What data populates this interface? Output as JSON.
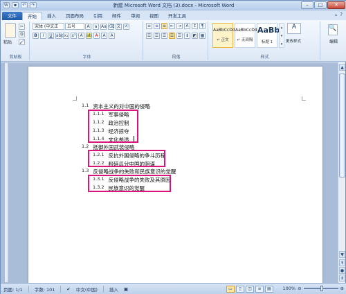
{
  "window": {
    "title": "新建 Microsoft Word 文档 (3).docx - Microsoft Word"
  },
  "qat": {
    "icons": [
      "save-icon",
      "undo-icon",
      "redo-icon"
    ]
  },
  "tabs": [
    "文件",
    "开始",
    "插入",
    "页面布局",
    "引用",
    "邮件",
    "审阅",
    "视图",
    "开发工具"
  ],
  "ribbon": {
    "clipboard": {
      "paste": "粘贴",
      "label": "剪贴板"
    },
    "font": {
      "family": "宋体 (中文正",
      "size": "五号",
      "label": "字体"
    },
    "paragraph": {
      "label": "段落"
    },
    "styles": {
      "label": "样式",
      "items": [
        {
          "preview": "AaBbCcDd",
          "name": "↵ 正文"
        },
        {
          "preview": "AaBbCcDd",
          "name": "↵ 无间隔"
        },
        {
          "preview": "AaBb",
          "name": "标题 1"
        }
      ],
      "change_styles": "更改样式"
    },
    "editing": {
      "label": "编辑"
    }
  },
  "document": {
    "sections": [
      {
        "num": "1.1",
        "text": "资本主义的对中国的侵略"
      },
      {
        "num": "1.1.1",
        "text": "军事侵略"
      },
      {
        "num": "1.1.2",
        "text": "政治控制"
      },
      {
        "num": "1.1.3",
        "text": "经济掠夺"
      },
      {
        "num": "1.1.4",
        "text": "文化参透"
      },
      {
        "num": "1.2",
        "text": "抵御外国武装侵略"
      },
      {
        "num": "1.2.1",
        "text": "反抗外国侵略的争斗历程"
      },
      {
        "num": "1.2.2",
        "text": "粉碎瓜分中国的阴谋"
      },
      {
        "num": "1.3",
        "text": "反侵略战争的失败和民族意识的觉醒"
      },
      {
        "num": "1.3.1",
        "text": "反侵略战争的失败及其原因"
      },
      {
        "num": "1.3.2",
        "text": "民族意识的觉醒"
      }
    ],
    "highlight_color": "#d8137a"
  },
  "status": {
    "page": "页面: 1/1",
    "words": "字数: 101",
    "language": "中文(中国)",
    "mode": "插入",
    "zoom": "100%"
  }
}
